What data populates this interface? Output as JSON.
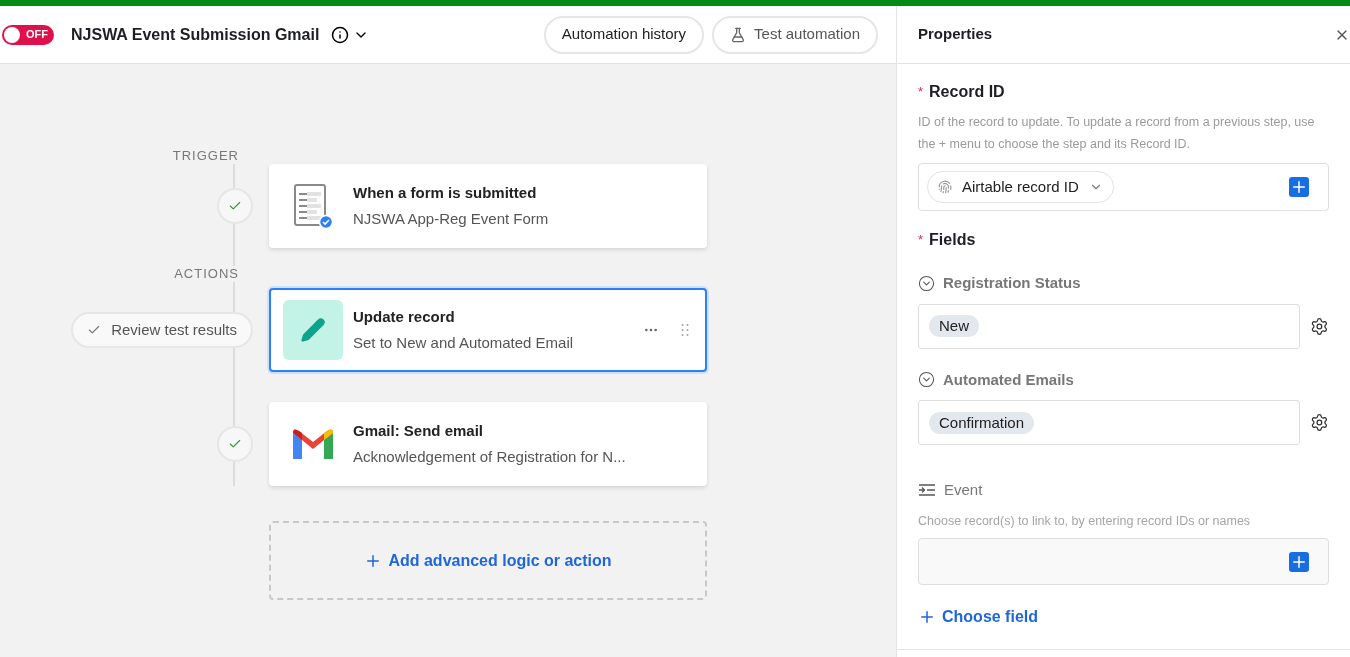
{
  "automation": {
    "enabled": false,
    "toggle_label": "OFF",
    "title": "NJSWA Event Submission Gmail"
  },
  "header_buttons": [
    {
      "kind": "history",
      "label": "Automation history"
    },
    {
      "kind": "test",
      "label": "Test automation"
    }
  ],
  "sections": [
    {
      "label": "TRIGGER",
      "steps": [
        {
          "kind": "form",
          "title": "When a form is submitted",
          "subtitle": "NJSWA App-Reg Event Form",
          "completed": true,
          "selected": false
        }
      ]
    },
    {
      "label": "ACTIONS",
      "steps": [
        {
          "kind": "update",
          "title": "Update record",
          "subtitle": "Set to New and Automated Email",
          "completed": false,
          "review_label": "Review test results",
          "selected": true
        },
        {
          "kind": "gmail",
          "title": "Gmail: Send email",
          "subtitle": "Acknowledgement of Registration for N...",
          "completed": true,
          "selected": false
        }
      ]
    }
  ],
  "add_action": {
    "label": "Add advanced logic or action"
  },
  "properties": {
    "title": "Properties",
    "record_id": {
      "label": "Record ID",
      "required_mark": "*",
      "help": "ID of the record to update. To update a record from a previous step, use the + menu to choose the step and its Record ID.",
      "token": "Airtable record ID"
    },
    "fields": {
      "label": "Fields",
      "required_mark": "*",
      "items": [
        {
          "kind": "select",
          "name": "Registration Status",
          "value": "New"
        },
        {
          "kind": "select",
          "name": "Automated Emails",
          "value": "Confirmation"
        },
        {
          "kind": "link",
          "name": "Event",
          "help": "Choose record(s) to link to, by entering record IDs or names"
        }
      ],
      "choose_field": "Choose field"
    }
  }
}
